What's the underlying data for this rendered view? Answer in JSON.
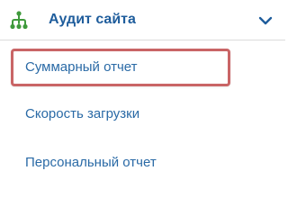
{
  "menu": {
    "section_title": "Аудит сайта",
    "section_icon": "sitemap-icon",
    "chevron_icon": "chevron-down-icon",
    "accent_color": "#1f5d9c",
    "highlight_border_color": "#c96566",
    "items": [
      {
        "label": "Суммарный отчет",
        "active": true
      },
      {
        "label": "Скорость загрузки",
        "active": false
      },
      {
        "label": "Персональный отчет",
        "active": false
      }
    ]
  }
}
